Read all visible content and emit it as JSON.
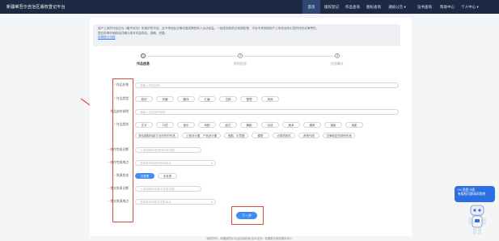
{
  "header": {
    "brand": "新疆维吾尔自治区版权登记平台",
    "nav": [
      {
        "label": "首页",
        "active": true
      },
      {
        "label": "版权登记",
        "active": false
      },
      {
        "label": "作品查询",
        "active": false
      },
      {
        "label": "图标查询",
        "active": false
      },
      {
        "label": "通知公告",
        "active": false
      },
      {
        "label": "证书查询",
        "active": false
      },
      {
        "label": "帮助中心",
        "active": false
      },
      {
        "label": "个人中心",
        "active": false
      }
    ]
  },
  "notice": {
    "line1": "用户上传的作品应为《著作权法》所保护的作品，且不得违反法律法规或侵犯他人合法权益，一经发现将依法依规处理，平台不承担因用户上传作品所引发的任何法律责任。",
    "line2": "提交前请仔细阅读并确认填写内容真实、准确、完整。",
    "link": "查看登记流程"
  },
  "steps": [
    {
      "num": "1",
      "label": "作品信息"
    },
    {
      "num": "2",
      "label": "权利信息"
    },
    {
      "num": "3",
      "label": "信息确认"
    }
  ],
  "form": {
    "title_label": "作品名称",
    "title_placeholder": "请输入作品名称",
    "category_label": "作品类型",
    "categories": [
      "原创",
      "改编",
      "翻译",
      "汇编",
      "注释",
      "整理",
      "其他"
    ],
    "desc_label": "作品创作说明",
    "desc_placeholder": "请输入作品创作说明",
    "type_label": "作品类别",
    "types_row1": [
      "文字",
      "口述",
      "音乐",
      "戏剧",
      "曲艺",
      "舞蹈",
      "杂技",
      "美术",
      "建筑",
      "摄影",
      "电影"
    ],
    "types_row2": [
      "类似摄制电影方法创作的作品",
      "工程设计图、产品设计图",
      "地图、示意图",
      "模型",
      "计算机软件",
      "其他作品",
      "法律规定的其他作品"
    ],
    "date_label": "创作完成日期",
    "date_placeholder": "请选择作品创作完成日期",
    "place_label": "创作完成地点",
    "place_placeholder": "请选择作品创作完成地点",
    "publish_label": "发表状态",
    "publish_options": [
      "已发表",
      "未发表"
    ],
    "pubdate_label": "首次发表日期",
    "pubdate_placeholder": "请选择作品首次发表日期",
    "pubplace_label": "首次发表地点",
    "pubplace_placeholder": "请选择作品首次发表地点"
  },
  "actions": {
    "next": "下一步"
  },
  "footer": "版权所有：新疆维吾尔自治区版权局  技术支持：新疆数字版权服务中心",
  "assistant": {
    "line1": "Hi! 我是小版",
    "line2": "有版权问题请问我吧"
  },
  "colors": {
    "accent": "#3f8cf5",
    "header": "#1c2a44",
    "annotation": "#e34a3a"
  }
}
